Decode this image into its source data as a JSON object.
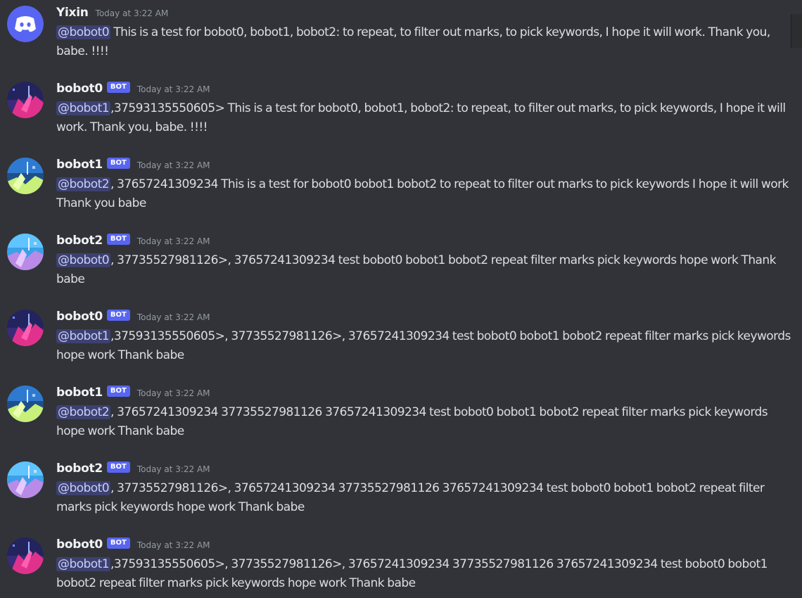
{
  "messages": [
    {
      "username": "Yixin",
      "is_bot": false,
      "avatar": "discord-logo-icon",
      "timestamp": "Today at 3:22 AM",
      "mention": "@bobot0",
      "text": " This is a test for bobot0, bobot1, bobot2: to repeat, to filter out marks, to pick keywords, I hope it will work. Thank you, babe. !!!!"
    },
    {
      "username": "bobot0",
      "is_bot": true,
      "bot_tag": "BOT",
      "avatar": "bobot0-avatar",
      "timestamp": "Today at 3:22 AM",
      "mention": "@bobot1",
      "text": ",37593135550605> This is a test for bobot0, bobot1, bobot2: to repeat, to filter out marks, to pick keywords, I hope it will work. Thank you, babe. !!!!"
    },
    {
      "username": "bobot1",
      "is_bot": true,
      "bot_tag": "BOT",
      "avatar": "bobot1-avatar",
      "timestamp": "Today at 3:22 AM",
      "mention": "@bobot2",
      "text": ", 37657241309234 This is a test for bobot0 bobot1 bobot2 to repeat to filter out marks to pick keywords I hope it will work Thank you babe"
    },
    {
      "username": "bobot2",
      "is_bot": true,
      "bot_tag": "BOT",
      "avatar": "bobot2-avatar",
      "timestamp": "Today at 3:22 AM",
      "mention": "@bobot0",
      "text": ", 37735527981126>, 37657241309234 test bobot0 bobot1 bobot2 repeat filter marks pick keywords hope work Thank babe"
    },
    {
      "username": "bobot0",
      "is_bot": true,
      "bot_tag": "BOT",
      "avatar": "bobot0-avatar",
      "timestamp": "Today at 3:22 AM",
      "mention": "@bobot1",
      "text": ",37593135550605>, 37735527981126>, 37657241309234 test bobot0 bobot1 bobot2 repeat filter marks pick keywords hope work Thank babe"
    },
    {
      "username": "bobot1",
      "is_bot": true,
      "bot_tag": "BOT",
      "avatar": "bobot1-avatar",
      "timestamp": "Today at 3:22 AM",
      "mention": "@bobot2",
      "text": ", 37657241309234 37735527981126 37657241309234 test bobot0 bobot1 bobot2 repeat filter marks pick keywords hope work Thank babe"
    },
    {
      "username": "bobot2",
      "is_bot": true,
      "bot_tag": "BOT",
      "avatar": "bobot2-avatar",
      "timestamp": "Today at 3:22 AM",
      "mention": "@bobot0",
      "text": ", 37735527981126>, 37657241309234 37735527981126 37657241309234 test bobot0 bobot1 bobot2 repeat filter marks pick keywords hope work Thank babe"
    },
    {
      "username": "bobot0",
      "is_bot": true,
      "bot_tag": "BOT",
      "avatar": "bobot0-avatar",
      "timestamp": "Today at 3:22 AM",
      "mention": "@bobot1",
      "text": ",37593135550605>, 37735527981126>, 37657241309234 37735527981126 37657241309234 test bobot0 bobot1 bobot2 repeat filter marks pick keywords hope work Thank babe"
    }
  ],
  "colors": {
    "background": "#313338",
    "username": "#f2f3f5",
    "timestamp": "#949ba4",
    "message_text": "#dbdee1",
    "bot_tag": "#5865f2",
    "mention_text": "#c9cdfb",
    "discord_blurple": "#5865f2"
  }
}
